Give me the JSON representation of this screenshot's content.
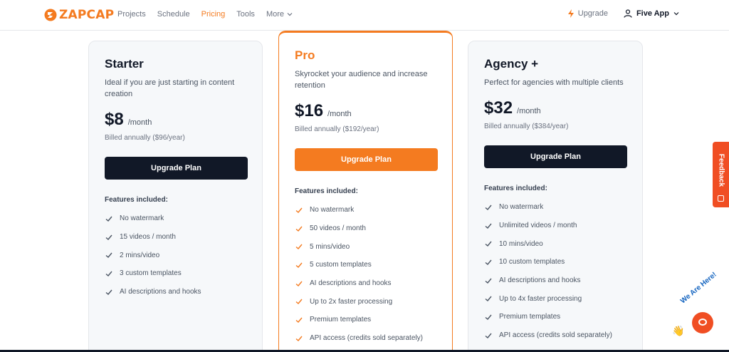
{
  "header": {
    "logo_text": "ZAPCAP",
    "nav": [
      {
        "label": "Projects",
        "active": false
      },
      {
        "label": "Schedule",
        "active": false
      },
      {
        "label": "Pricing",
        "active": true
      },
      {
        "label": "Tools",
        "active": false
      }
    ],
    "more_label": "More",
    "upgrade_label": "Upgrade",
    "account_label": "Five App"
  },
  "plans": [
    {
      "name": "Starter",
      "description": "Ideal if you are just starting in content creation",
      "price": "$8",
      "period": "/month",
      "billed": "Billed annually ($96/year)",
      "button": "Upgrade Plan",
      "features_title": "Features included:",
      "features": [
        "No watermark",
        "15 videos / month",
        "2 mins/video",
        "3 custom templates",
        "AI descriptions and hooks"
      ]
    },
    {
      "name": "Pro",
      "description": "Skyrocket your audience and increase retention",
      "price": "$16",
      "period": "/month",
      "billed": "Billed annually ($192/year)",
      "button": "Upgrade Plan",
      "features_title": "Features included:",
      "features": [
        "No watermark",
        "50 videos / month",
        "5 mins/video",
        "5 custom templates",
        "AI descriptions and hooks",
        "Up to 2x faster processing",
        "Premium templates",
        "API access (credits sold separately)"
      ]
    },
    {
      "name": "Agency +",
      "description": "Perfect for agencies with multiple clients",
      "price": "$32",
      "period": "/month",
      "billed": "Billed annually ($384/year)",
      "button": "Upgrade Plan",
      "features_title": "Features included:",
      "features": [
        "No watermark",
        "Unlimited videos / month",
        "10 mins/video",
        "10 custom templates",
        "AI descriptions and hooks",
        "Up to 4x faster processing",
        "Premium templates",
        "API access (credits sold separately)"
      ]
    }
  ],
  "feedback_label": "Feedback",
  "chat": {
    "here_text": "We Are Here!"
  },
  "colors": {
    "brand": "#f47b20",
    "dark": "#111827",
    "feedback": "#f04e23",
    "check": "#4b5563"
  }
}
